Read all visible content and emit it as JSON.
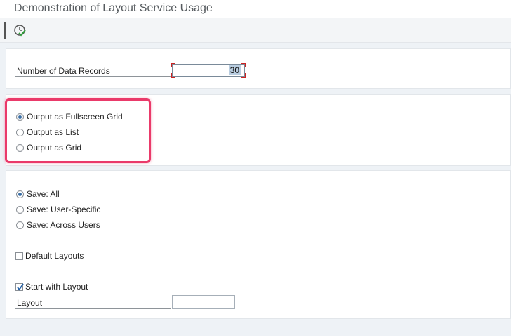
{
  "window": {
    "title": "Demonstration of Layout Service Usage"
  },
  "toolbar": {
    "execute_icon": "execute-clock-icon"
  },
  "records": {
    "label": "Number of Data Records",
    "value": "30"
  },
  "output_options": [
    {
      "label": "Output as Fullscreen Grid",
      "selected": true
    },
    {
      "label": "Output as List",
      "selected": false
    },
    {
      "label": "Output as Grid",
      "selected": false
    }
  ],
  "save_options": [
    {
      "label": "Save: All",
      "selected": true
    },
    {
      "label": "Save: User-Specific",
      "selected": false
    },
    {
      "label": "Save: Across Users",
      "selected": false
    }
  ],
  "default_layouts": {
    "label": "Default Layouts",
    "checked": false
  },
  "start_with_layout": {
    "label": "Start with Layout",
    "checked": true
  },
  "layout": {
    "label": "Layout",
    "value": ""
  },
  "colors": {
    "highlight": "#ea3a6a",
    "radio_dot": "#3a6ea5",
    "checkmark": "#1f5fa8"
  }
}
